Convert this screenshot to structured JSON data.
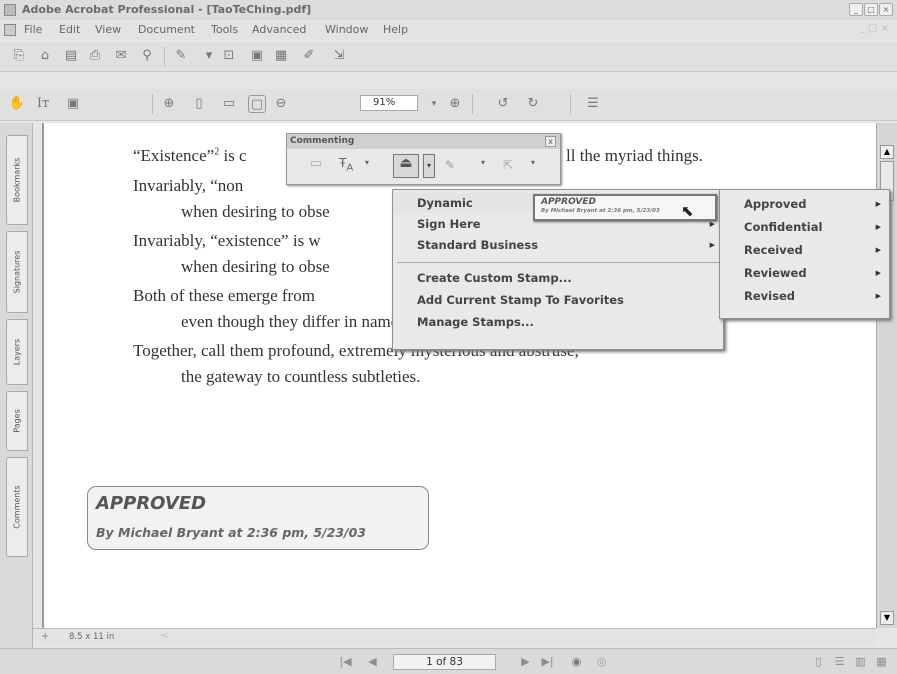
{
  "window": {
    "title": "Adobe Acrobat Professional - [TaoTeChing.pdf]"
  },
  "menubar": [
    "File",
    "Edit",
    "View",
    "Document",
    "Tools",
    "Advanced",
    "Window",
    "Help"
  ],
  "toolbar": {
    "zoom": "91%"
  },
  "nav_tabs": [
    "Bookmarks",
    "Signatures",
    "Layers",
    "Pages",
    "Comments"
  ],
  "document": {
    "lines": [
      {
        "a": "“Existence”",
        "sup": "2",
        "b": " is c"
      },
      {
        "a": "ll the myriad things."
      },
      {
        "a": "Invariably, “non"
      },
      {
        "a": "when desiring to obse"
      },
      {
        "a": "Invariably, “existence” is w"
      },
      {
        "a": "when desiring to obse"
      },
      {
        "a": "Both of these emerge from"
      },
      {
        "a": "even though they differ in name."
      },
      {
        "a": "Together, call them profound, extremely mysterious and abstruse;"
      },
      {
        "a": "the gateway to countless subtleties."
      }
    ]
  },
  "stamp": {
    "title": "APPROVED",
    "byline": "By Michael Bryant at 2:36 pm, 5/23/03"
  },
  "commenting": {
    "title": "Commenting",
    "close": "x"
  },
  "stamp_menu": {
    "items": [
      "Dynamic",
      "Sign Here",
      "Standard Business"
    ],
    "commands": [
      "Create Custom Stamp...",
      "Add Current Stamp To Favorites",
      "Manage Stamps..."
    ],
    "preview": {
      "title": "APPROVED",
      "byline": "By Michael Bryant at 2:36 pm, 5/23/03"
    }
  },
  "dynamic_submenu": [
    "Approved",
    "Confidential",
    "Received",
    "Reviewed",
    "Revised"
  ],
  "statusbar": {
    "page_size": "8.5 x 11 in",
    "page_indicator": "1 of 83"
  }
}
